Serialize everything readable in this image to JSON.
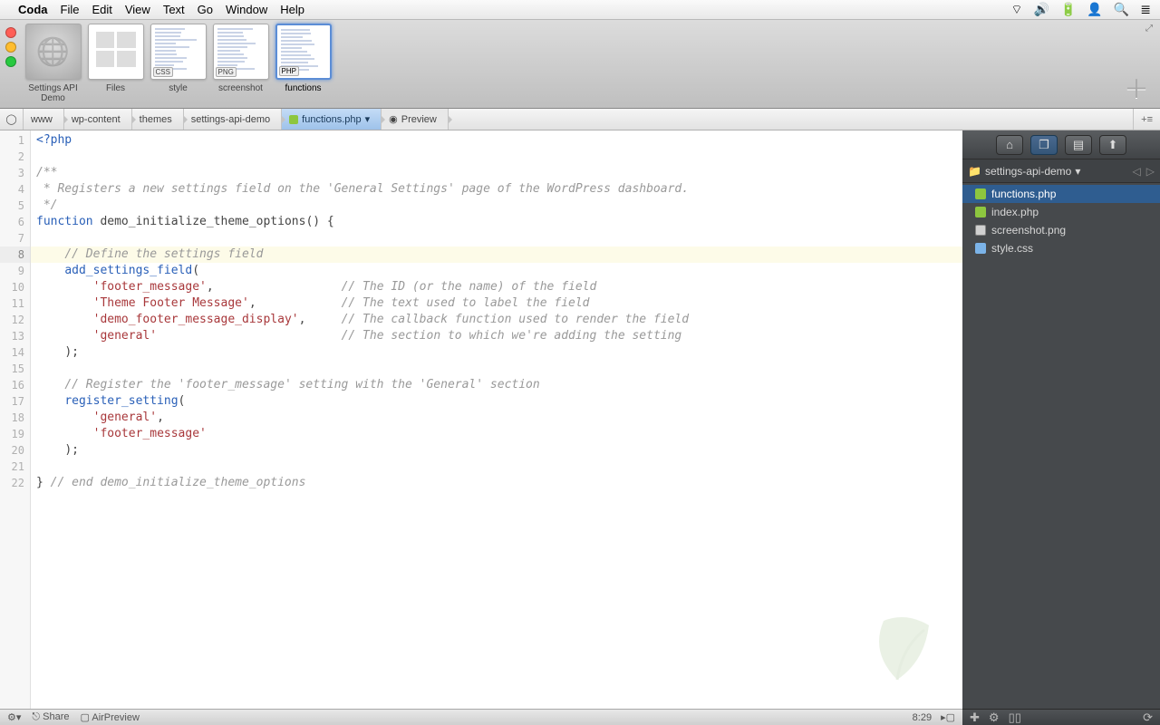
{
  "menubar": {
    "app": "Coda",
    "items": [
      "File",
      "Edit",
      "View",
      "Text",
      "Go",
      "Window",
      "Help"
    ]
  },
  "toolbar": {
    "tabs": [
      {
        "label": "Settings API Demo",
        "kind": "site"
      },
      {
        "label": "Files",
        "kind": "files"
      },
      {
        "label": "style",
        "badge": "CSS"
      },
      {
        "label": "screenshot",
        "badge": "PNG"
      },
      {
        "label": "functions",
        "badge": "PHP",
        "active": true
      }
    ]
  },
  "pathbar": {
    "crumbs": [
      "www",
      "wp-content",
      "themes",
      "settings-api-demo"
    ],
    "file": "functions.php",
    "preview": "Preview"
  },
  "code": {
    "currentLine": 8,
    "lines": [
      [
        [
          "tok-kw",
          "<?php"
        ]
      ],
      [],
      [
        [
          "tok-cm",
          "/**"
        ]
      ],
      [
        [
          "tok-cm",
          " * Registers a new settings field on the 'General Settings' page of the WordPress dashboard."
        ]
      ],
      [
        [
          "tok-cm",
          " */"
        ]
      ],
      [
        [
          "tok-kw",
          "function"
        ],
        [
          "",
          " "
        ],
        [
          "tok-name",
          "demo_initialize_theme_options"
        ],
        [
          "tok-punc",
          "() {"
        ]
      ],
      [],
      [
        [
          "",
          "    "
        ],
        [
          "tok-cm",
          "// Define the settings field"
        ]
      ],
      [
        [
          "",
          "    "
        ],
        [
          "tok-fn",
          "add_settings_field"
        ],
        [
          "tok-punc",
          "("
        ]
      ],
      [
        [
          "",
          "        "
        ],
        [
          "tok-str",
          "'footer_message'"
        ],
        [
          "tok-punc",
          ","
        ],
        [
          "",
          "                  "
        ],
        [
          "tok-cm",
          "// The ID (or the name) of the field"
        ]
      ],
      [
        [
          "",
          "        "
        ],
        [
          "tok-str",
          "'Theme Footer Message'"
        ],
        [
          "tok-punc",
          ","
        ],
        [
          "",
          "            "
        ],
        [
          "tok-cm",
          "// The text used to label the field"
        ]
      ],
      [
        [
          "",
          "        "
        ],
        [
          "tok-str",
          "'demo_footer_message_display'"
        ],
        [
          "tok-punc",
          ","
        ],
        [
          "",
          "     "
        ],
        [
          "tok-cm",
          "// The callback function used to render the field"
        ]
      ],
      [
        [
          "",
          "        "
        ],
        [
          "tok-str",
          "'general'"
        ],
        [
          "",
          "                          "
        ],
        [
          "tok-cm",
          "// The section to which we're adding the setting"
        ]
      ],
      [
        [
          "",
          "    "
        ],
        [
          "tok-punc",
          ");"
        ]
      ],
      [],
      [
        [
          "",
          "    "
        ],
        [
          "tok-cm",
          "// Register the 'footer_message' setting with the 'General' section"
        ]
      ],
      [
        [
          "",
          "    "
        ],
        [
          "tok-fn",
          "register_setting"
        ],
        [
          "tok-punc",
          "("
        ]
      ],
      [
        [
          "",
          "        "
        ],
        [
          "tok-str",
          "'general'"
        ],
        [
          "tok-punc",
          ","
        ]
      ],
      [
        [
          "",
          "        "
        ],
        [
          "tok-str",
          "'footer_message'"
        ]
      ],
      [
        [
          "",
          "    "
        ],
        [
          "tok-punc",
          ");"
        ]
      ],
      [],
      [
        [
          "tok-punc",
          "} "
        ],
        [
          "tok-cm",
          "// end demo_initialize_theme_options"
        ]
      ]
    ]
  },
  "sidebar": {
    "folder": "settings-api-demo",
    "files": [
      {
        "name": "functions.php",
        "icon": "php",
        "selected": true
      },
      {
        "name": "index.php",
        "icon": "php"
      },
      {
        "name": "screenshot.png",
        "icon": "png"
      },
      {
        "name": "style.css",
        "icon": "css"
      }
    ]
  },
  "statusbar": {
    "share": "Share",
    "airpreview": "AirPreview",
    "pos": "8:29"
  }
}
